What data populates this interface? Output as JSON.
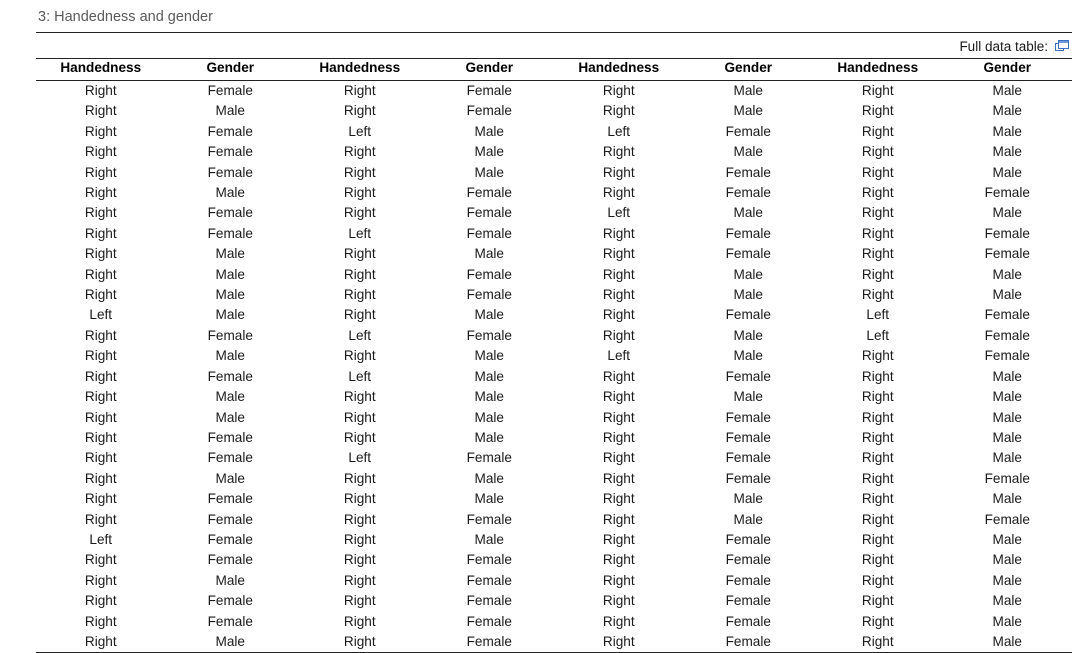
{
  "caption": "3: Handedness and gender",
  "full_data": {
    "label": "Full data table:",
    "icon": "copy-windows-icon",
    "icon_color": "#3b6fc4"
  },
  "table": {
    "columns": [
      "Handedness",
      "Gender",
      "Handedness",
      "Gender",
      "Handedness",
      "Gender",
      "Handedness",
      "Gender"
    ],
    "row_count": 28,
    "column_pairs": 4,
    "rows": [
      [
        "Right",
        "Female",
        "Right",
        "Female",
        "Right",
        "Male",
        "Right",
        "Male"
      ],
      [
        "Right",
        "Male",
        "Right",
        "Female",
        "Right",
        "Male",
        "Right",
        "Male"
      ],
      [
        "Right",
        "Female",
        "Left",
        "Male",
        "Left",
        "Female",
        "Right",
        "Male"
      ],
      [
        "Right",
        "Female",
        "Right",
        "Male",
        "Right",
        "Male",
        "Right",
        "Male"
      ],
      [
        "Right",
        "Female",
        "Right",
        "Male",
        "Right",
        "Female",
        "Right",
        "Male"
      ],
      [
        "Right",
        "Male",
        "Right",
        "Female",
        "Right",
        "Female",
        "Right",
        "Female"
      ],
      [
        "Right",
        "Female",
        "Right",
        "Female",
        "Left",
        "Male",
        "Right",
        "Male"
      ],
      [
        "Right",
        "Female",
        "Left",
        "Female",
        "Right",
        "Female",
        "Right",
        "Female"
      ],
      [
        "Right",
        "Male",
        "Right",
        "Male",
        "Right",
        "Female",
        "Right",
        "Female"
      ],
      [
        "Right",
        "Male",
        "Right",
        "Female",
        "Right",
        "Male",
        "Right",
        "Male"
      ],
      [
        "Right",
        "Male",
        "Right",
        "Female",
        "Right",
        "Male",
        "Right",
        "Male"
      ],
      [
        "Left",
        "Male",
        "Right",
        "Male",
        "Right",
        "Female",
        "Left",
        "Female"
      ],
      [
        "Right",
        "Female",
        "Left",
        "Female",
        "Right",
        "Male",
        "Left",
        "Female"
      ],
      [
        "Right",
        "Male",
        "Right",
        "Male",
        "Left",
        "Male",
        "Right",
        "Female"
      ],
      [
        "Right",
        "Female",
        "Left",
        "Male",
        "Right",
        "Female",
        "Right",
        "Male"
      ],
      [
        "Right",
        "Male",
        "Right",
        "Male",
        "Right",
        "Male",
        "Right",
        "Male"
      ],
      [
        "Right",
        "Male",
        "Right",
        "Male",
        "Right",
        "Female",
        "Right",
        "Male"
      ],
      [
        "Right",
        "Female",
        "Right",
        "Male",
        "Right",
        "Female",
        "Right",
        "Male"
      ],
      [
        "Right",
        "Female",
        "Left",
        "Female",
        "Right",
        "Female",
        "Right",
        "Male"
      ],
      [
        "Right",
        "Male",
        "Right",
        "Male",
        "Right",
        "Female",
        "Right",
        "Female"
      ],
      [
        "Right",
        "Female",
        "Right",
        "Male",
        "Right",
        "Male",
        "Right",
        "Male"
      ],
      [
        "Right",
        "Female",
        "Right",
        "Female",
        "Right",
        "Male",
        "Right",
        "Female"
      ],
      [
        "Left",
        "Female",
        "Right",
        "Male",
        "Right",
        "Female",
        "Right",
        "Male"
      ],
      [
        "Right",
        "Female",
        "Right",
        "Female",
        "Right",
        "Female",
        "Right",
        "Male"
      ],
      [
        "Right",
        "Male",
        "Right",
        "Female",
        "Right",
        "Female",
        "Right",
        "Male"
      ],
      [
        "Right",
        "Female",
        "Right",
        "Female",
        "Right",
        "Female",
        "Right",
        "Male"
      ],
      [
        "Right",
        "Female",
        "Right",
        "Female",
        "Right",
        "Female",
        "Right",
        "Male"
      ],
      [
        "Right",
        "Male",
        "Right",
        "Female",
        "Right",
        "Female",
        "Right",
        "Male"
      ]
    ]
  }
}
